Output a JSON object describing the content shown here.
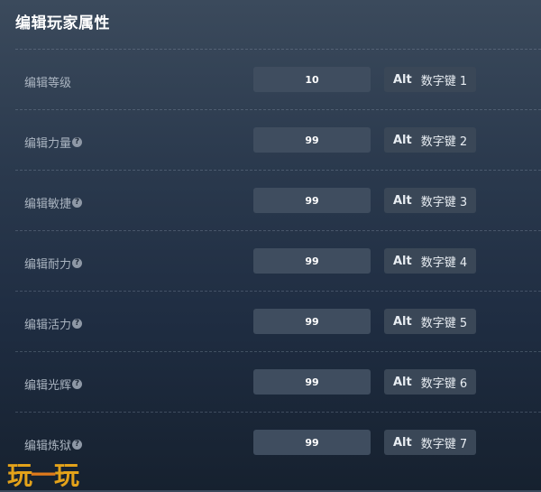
{
  "header": {
    "title": "编辑玩家属性"
  },
  "rows": [
    {
      "label": "编辑等级",
      "help": false,
      "value": "10",
      "modifier": "Alt",
      "key": "数字键 1"
    },
    {
      "label": "编辑力量",
      "help": true,
      "value": "99",
      "modifier": "Alt",
      "key": "数字键 2"
    },
    {
      "label": "编辑敏捷",
      "help": true,
      "value": "99",
      "modifier": "Alt",
      "key": "数字键 3"
    },
    {
      "label": "编辑耐力",
      "help": true,
      "value": "99",
      "modifier": "Alt",
      "key": "数字键 4"
    },
    {
      "label": "编辑活力",
      "help": true,
      "value": "99",
      "modifier": "Alt",
      "key": "数字键 5"
    },
    {
      "label": "编辑光辉",
      "help": true,
      "value": "99",
      "modifier": "Alt",
      "key": "数字键 6"
    },
    {
      "label": "编辑炼狱",
      "help": true,
      "value": "99",
      "modifier": "Alt",
      "key": "数字键 7"
    }
  ],
  "help_glyph": "?",
  "watermark": {
    "part1": "玩",
    "part2": "一",
    "part3": "玩"
  }
}
